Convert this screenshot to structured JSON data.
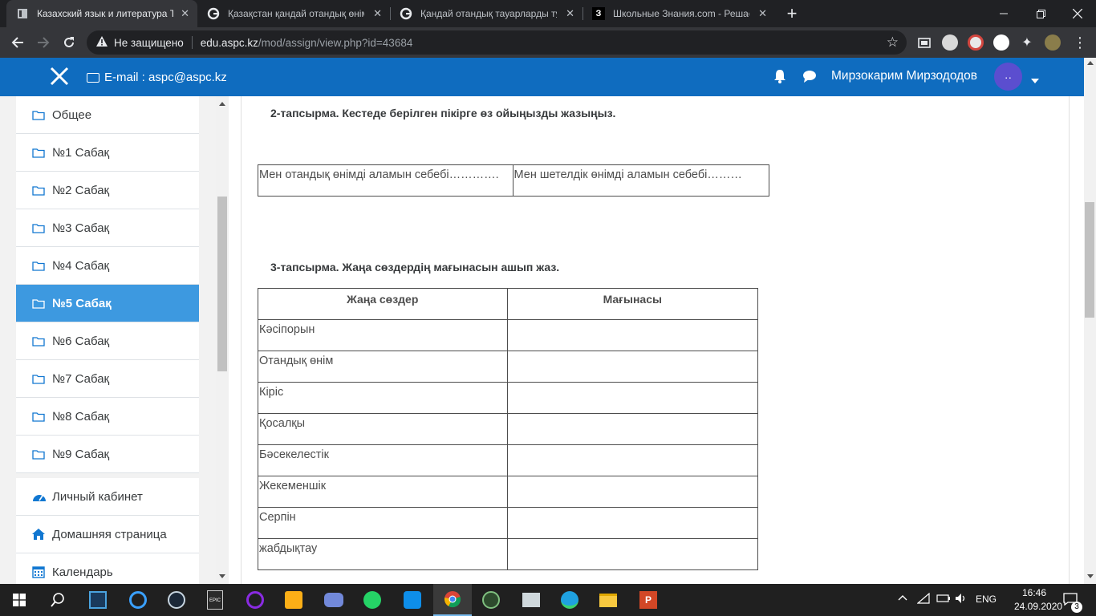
{
  "browser": {
    "tabs": [
      {
        "title": "Казахский язык и литература Т2",
        "active": true
      },
      {
        "title": "Қазақстан қандай отандық өнім",
        "active": false
      },
      {
        "title": "Қандай отандық тауарларды тұт",
        "active": false
      },
      {
        "title": "Школьные Знания.com - Решае",
        "active": false
      }
    ],
    "address": {
      "security_label": "Не защищено",
      "host": "edu.aspc.kz",
      "path": "/mod/assign/view.php?id=43684"
    }
  },
  "header": {
    "email_label": "E-mail : aspc@aspc.kz",
    "user_name": "Мирзокарим Мирзододов",
    "avatar_text": "··"
  },
  "sidebar": {
    "items": [
      {
        "label": "Общее",
        "icon": "folder-icon"
      },
      {
        "label": "№1 Сабақ",
        "icon": "folder-icon"
      },
      {
        "label": "№2 Сабақ",
        "icon": "folder-icon"
      },
      {
        "label": "№3 Сабақ",
        "icon": "folder-icon"
      },
      {
        "label": "№4 Сабақ",
        "icon": "folder-icon"
      },
      {
        "label": "№5 Сабақ",
        "icon": "folder-icon",
        "active": true
      },
      {
        "label": "№6 Сабақ",
        "icon": "folder-icon"
      },
      {
        "label": "№7 Сабақ",
        "icon": "folder-icon"
      },
      {
        "label": "№8 Сабақ",
        "icon": "folder-icon"
      },
      {
        "label": "№9 Сабақ",
        "icon": "folder-icon"
      }
    ],
    "links": [
      {
        "label": "Личный кабинет",
        "icon": "dashboard-icon"
      },
      {
        "label": "Домашняя страница",
        "icon": "home-icon"
      },
      {
        "label": "Календарь",
        "icon": "calendar-icon"
      }
    ]
  },
  "content": {
    "task2": {
      "title": "2-тапсырма. Кестеде берілген пікірге өз ойыңызды жазыңыз.",
      "cells": [
        "Мен отандық өнімді аламын себебі………….",
        "Мен шетелдік өнімді аламын себебі………"
      ]
    },
    "task3": {
      "title": "3-тапсырма. Жаңа сөздердің мағынасын ашып жаз.",
      "headers": [
        "Жаңа сөздер",
        "Мағынасы"
      ],
      "rows": [
        "Кәсіпорын",
        "Отандық өнім",
        "Кіріс",
        "Қосалқы",
        "Бәсекелестік",
        "Жекеменшік",
        "Серпін",
        "жабдықтау"
      ]
    }
  },
  "taskbar": {
    "language": "ENG",
    "time": "16:46",
    "date": "24.09.2020",
    "notifications": "3"
  },
  "colors": {
    "header_bg": "#0f6cbf",
    "active_nav": "#3d99e0",
    "avatar_bg": "#5b4ecf"
  }
}
